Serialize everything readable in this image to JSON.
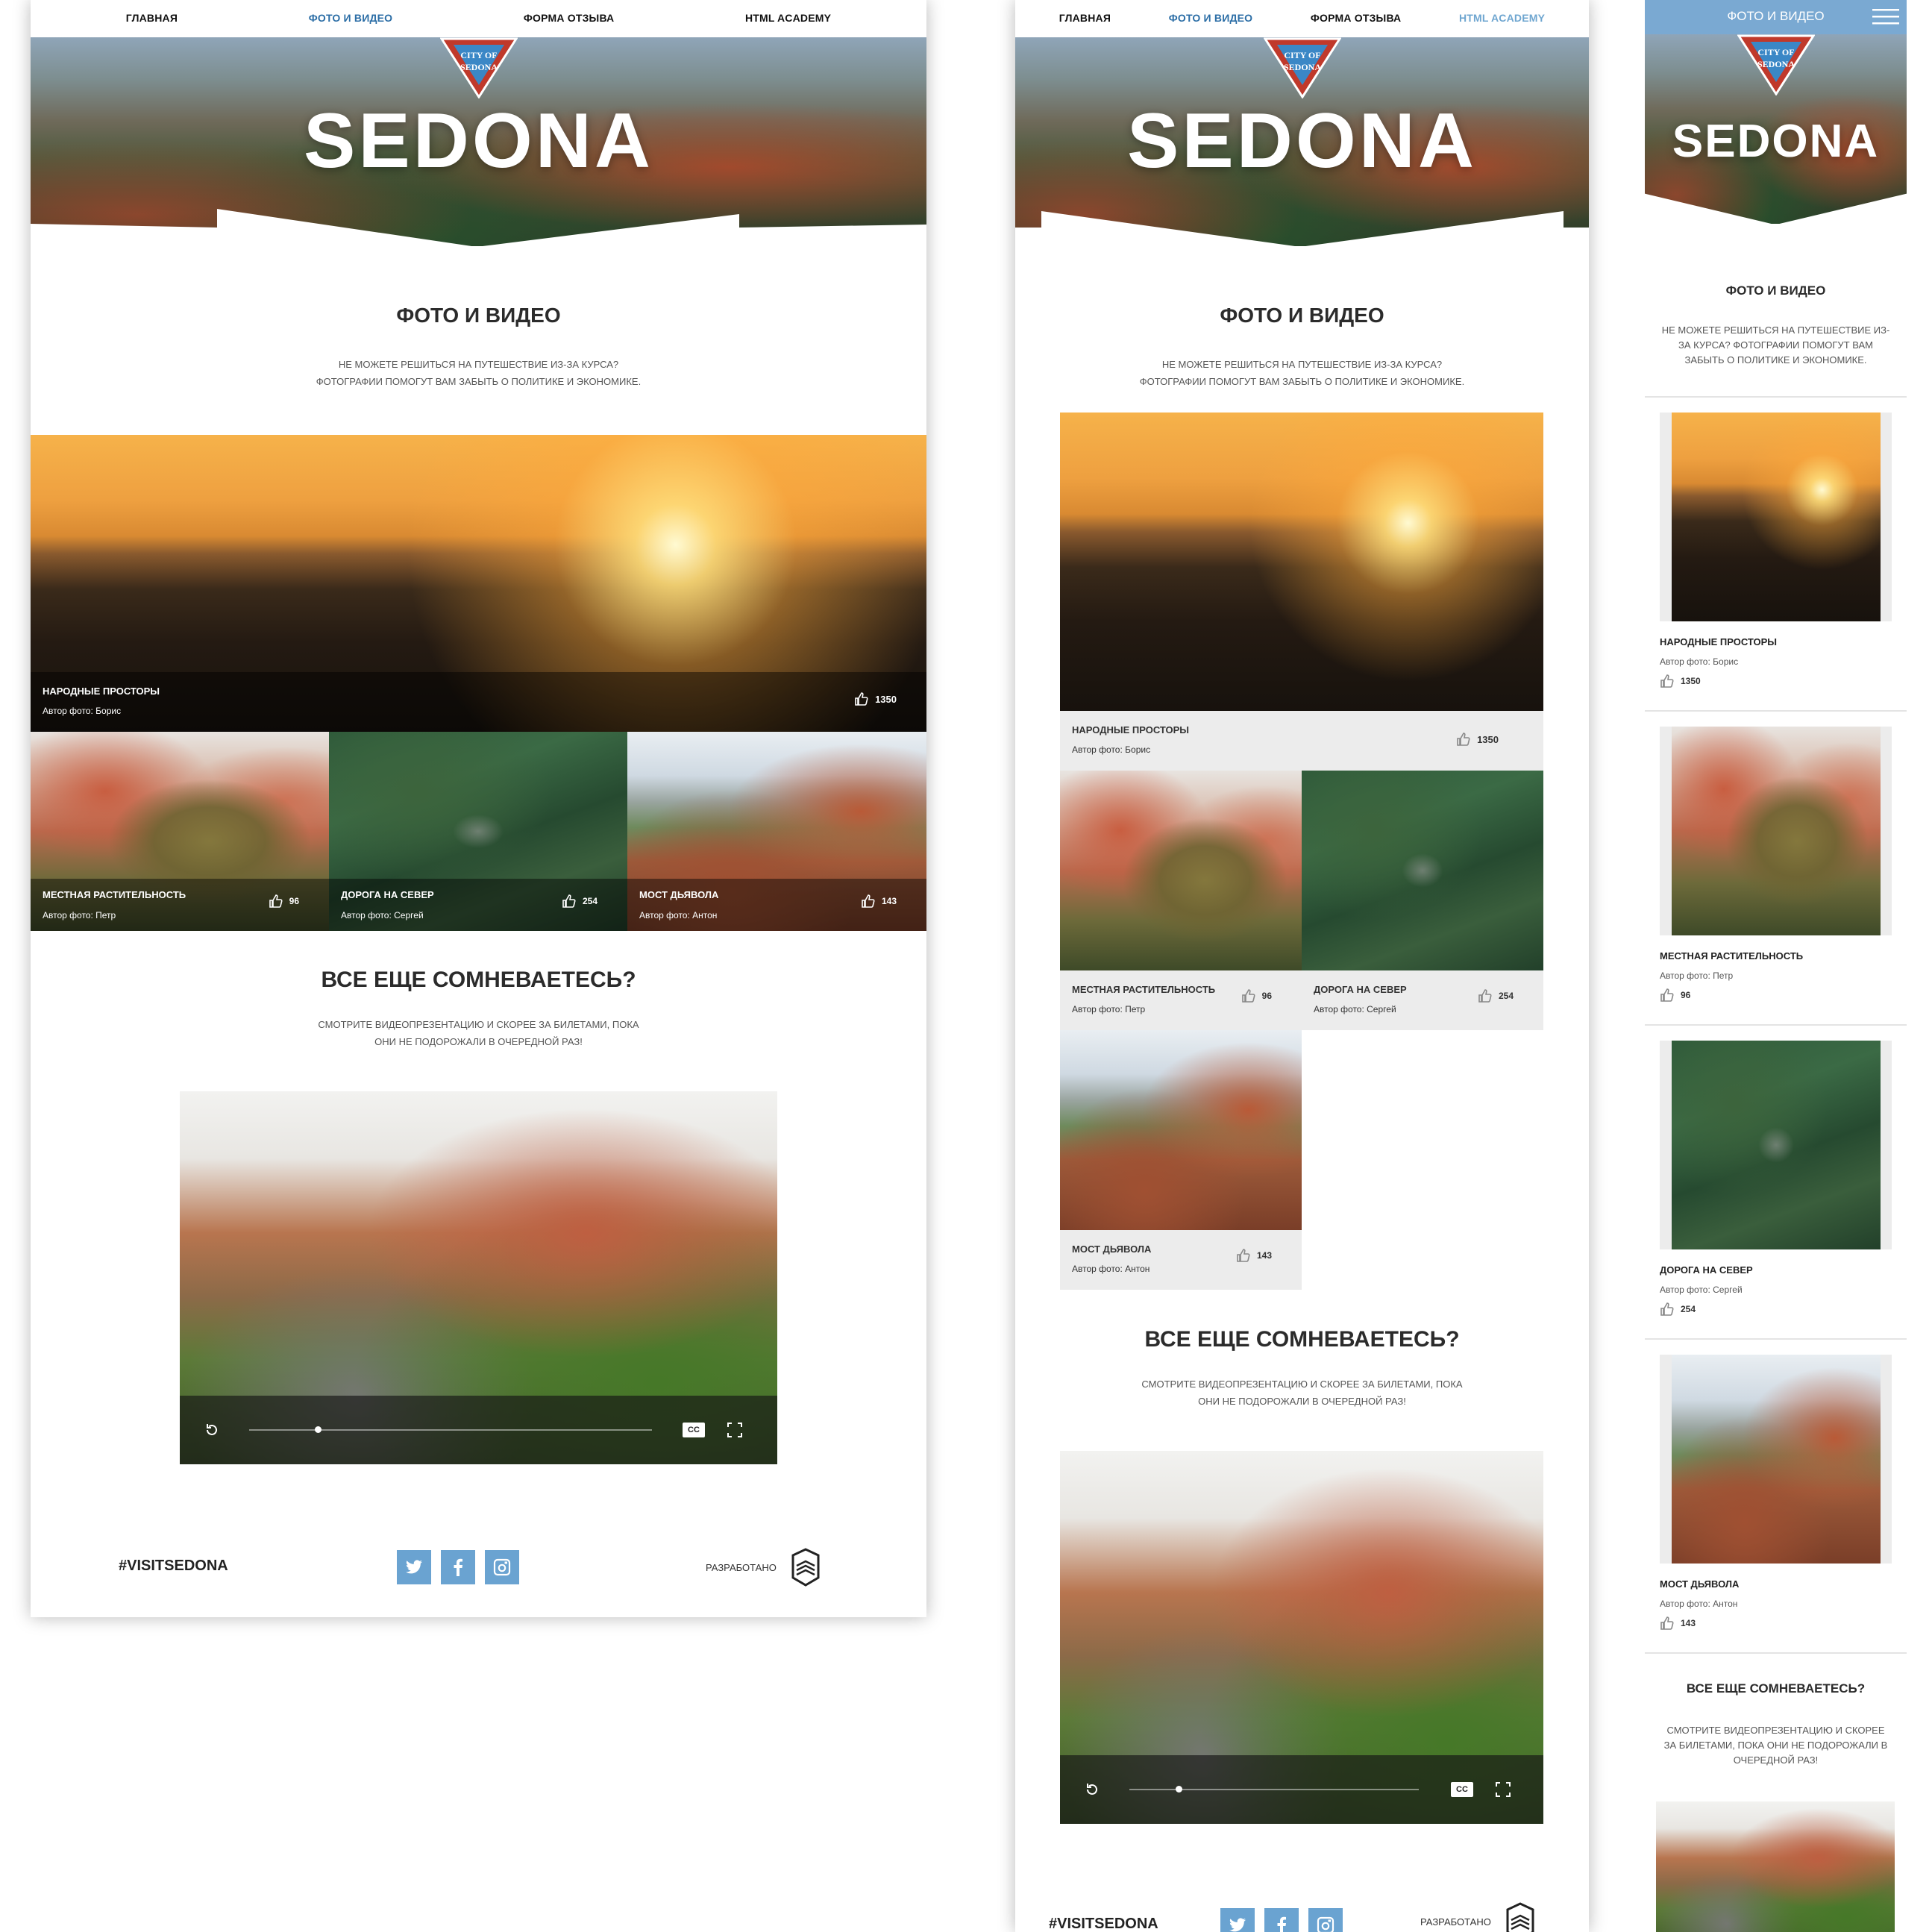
{
  "nav": {
    "home": "Главная",
    "photo": "Фото и видео",
    "form": "Форма отзыва",
    "academy": "HTML Academy"
  },
  "hero": {
    "title": "SEDONA",
    "badge_line1": "CITY OF",
    "badge_line2": "SEDONA"
  },
  "gallery": {
    "title": "Фото и видео",
    "intro_line1": "Не можете решиться на путешествие из-за курса?",
    "intro_line2": "Фотографии помогут вам забыть о политике и экономике.",
    "intro_mobile": "Не можете решиться на путешествие из-за курса? Фотографии помогут вам забыть о политике и экономике.",
    "photos": [
      {
        "title": "Народные просторы",
        "author": "Автор фото: Борис",
        "likes": "1350"
      },
      {
        "title": "Местная растительность",
        "author": "Автор фото: Петр",
        "likes": "96"
      },
      {
        "title": "Дорога на север",
        "author": "Автор фото: Сергей",
        "likes": "254"
      },
      {
        "title": "Мост дьявола",
        "author": "Автор фото: Антон",
        "likes": "143"
      }
    ]
  },
  "video": {
    "title": "Все еще сомневаетесь?",
    "text_line1": "Смотрите видеопрезентацию и скорее за билетами, пока",
    "text_line2": "они не подорожали в очередной раз!",
    "text_mobile": "Смотрите видеопрезентацию и скорее за билетами, пока они не подорожали в очередной раз!",
    "cc_label": "CC",
    "progress": 0.17
  },
  "footer": {
    "hashtag": "#VISITSEDONA",
    "developed": "Разработано"
  },
  "colors": {
    "accent": "#2c6ea6",
    "social": "#6aa3d1",
    "caption_light": "#ececec"
  }
}
